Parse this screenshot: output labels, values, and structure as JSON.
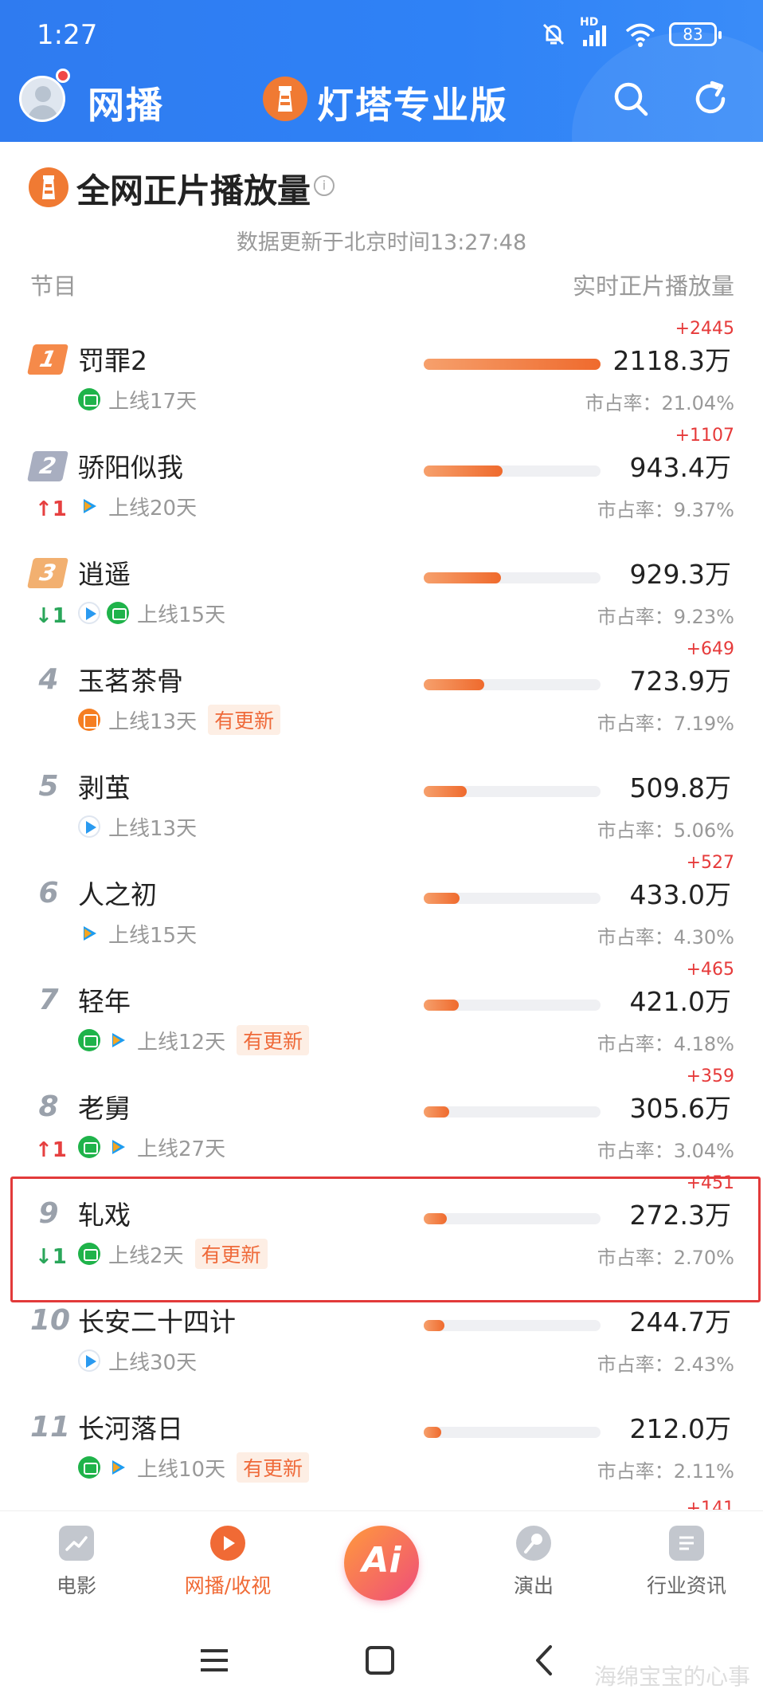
{
  "status_bar": {
    "time": "1:27",
    "battery": "83",
    "network": "HD"
  },
  "header": {
    "section": "网播",
    "brand": "灯塔专业版"
  },
  "page": {
    "title": "全网正片播放量",
    "update_time": "数据更新于北京时间13:27:48",
    "col_program": "节目",
    "col_metric": "实时正片播放量"
  },
  "rows": [
    {
      "rank": "1",
      "title": "罚罪2",
      "days": "上线17天",
      "platforms": [
        "iqiyi"
      ],
      "value": "2118.3万",
      "share": "市占率：21.04%",
      "delta": "+2445",
      "trend": "",
      "tag": "",
      "bar": 1.0
    },
    {
      "rank": "2",
      "title": "骄阳似我",
      "days": "上线20天",
      "platforms": [
        "tencent"
      ],
      "value": "943.4万",
      "share": "市占率：9.37%",
      "delta": "+1107",
      "trend": "↑1",
      "tag": "",
      "bar": 0.445
    },
    {
      "rank": "3",
      "title": "逍遥",
      "days": "上线15天",
      "platforms": [
        "youku",
        "iqiyi"
      ],
      "value": "929.3万",
      "share": "市占率：9.23%",
      "delta": "",
      "trend": "↓1",
      "tag": "",
      "bar": 0.439
    },
    {
      "rank": "4",
      "title": "玉茗茶骨",
      "days": "上线13天",
      "platforms": [
        "mgtv"
      ],
      "value": "723.9万",
      "share": "市占率：7.19%",
      "delta": "+649",
      "trend": "",
      "tag": "有更新",
      "bar": 0.342
    },
    {
      "rank": "5",
      "title": "剥茧",
      "days": "上线13天",
      "platforms": [
        "youku"
      ],
      "value": "509.8万",
      "share": "市占率：5.06%",
      "delta": "",
      "trend": "",
      "tag": "",
      "bar": 0.241
    },
    {
      "rank": "6",
      "title": "人之初",
      "days": "上线15天",
      "platforms": [
        "tencent"
      ],
      "value": "433.0万",
      "share": "市占率：4.30%",
      "delta": "+527",
      "trend": "",
      "tag": "",
      "bar": 0.204
    },
    {
      "rank": "7",
      "title": "轻年",
      "days": "上线12天",
      "platforms": [
        "iqiyi",
        "tencent"
      ],
      "value": "421.0万",
      "share": "市占率：4.18%",
      "delta": "+465",
      "trend": "",
      "tag": "有更新",
      "bar": 0.199
    },
    {
      "rank": "8",
      "title": "老舅",
      "days": "上线27天",
      "platforms": [
        "iqiyi",
        "tencent"
      ],
      "value": "305.6万",
      "share": "市占率：3.04%",
      "delta": "+359",
      "trend": "↑1",
      "tag": "",
      "bar": 0.144
    },
    {
      "rank": "9",
      "title": "轧戏",
      "days": "上线2天",
      "platforms": [
        "iqiyi"
      ],
      "value": "272.3万",
      "share": "市占率：2.70%",
      "delta": "+451",
      "trend": "↓1",
      "tag": "有更新",
      "bar": 0.129
    },
    {
      "rank": "10",
      "title": "长安二十四计",
      "days": "上线30天",
      "platforms": [
        "youku"
      ],
      "value": "244.7万",
      "share": "市占率：2.43%",
      "delta": "",
      "trend": "",
      "tag": "",
      "bar": 0.116
    },
    {
      "rank": "11",
      "title": "长河落日",
      "days": "上线10天",
      "platforms": [
        "iqiyi",
        "tencent"
      ],
      "value": "212.0万",
      "share": "市占率：2.11%",
      "delta": "",
      "trend": "",
      "tag": "有更新",
      "bar": 0.1
    }
  ],
  "partial_next_delta": "+141",
  "bottom_nav": {
    "items": [
      {
        "label": "电影",
        "active": false
      },
      {
        "label": "网播/收视",
        "active": true
      },
      {
        "label": "演出",
        "active": false
      },
      {
        "label": "行业资讯",
        "active": false
      }
    ],
    "center_label": "Ai"
  },
  "watermark": "海绵宝宝的心事",
  "colors": {
    "header_blue": "#2f7bf0",
    "accent_orange": "#ef6a2d",
    "up_red": "#e64040",
    "down_green": "#2aa65a",
    "highlight_red": "#e23a3a"
  }
}
